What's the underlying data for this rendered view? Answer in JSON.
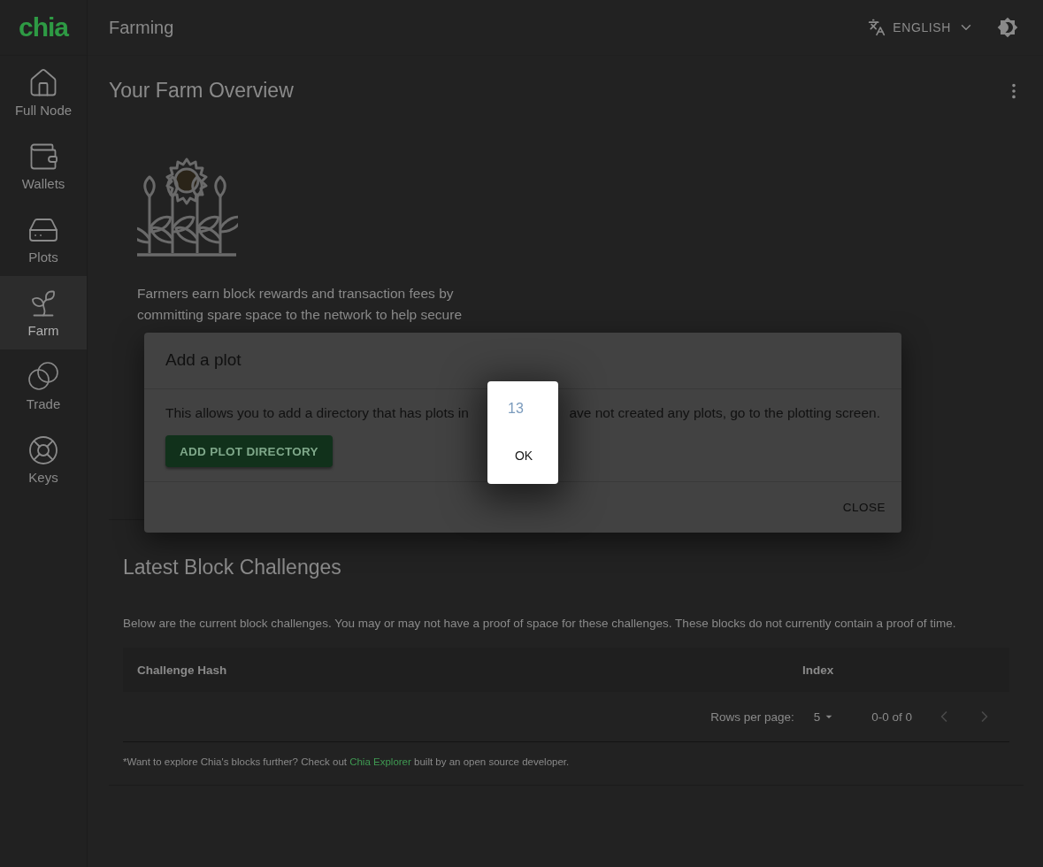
{
  "logo": "chia",
  "sidebar": {
    "items": [
      {
        "label": "Full Node",
        "selected": false
      },
      {
        "label": "Wallets",
        "selected": false
      },
      {
        "label": "Plots",
        "selected": false
      },
      {
        "label": "Farm",
        "selected": true
      },
      {
        "label": "Trade",
        "selected": false
      },
      {
        "label": "Keys",
        "selected": false
      }
    ]
  },
  "header": {
    "title": "Farming",
    "language": "ENGLISH"
  },
  "overview": {
    "title": "Your Farm Overview",
    "description": "Farmers earn block rewards and transaction fees by committing spare space to the network to help secure"
  },
  "challenges": {
    "title": "Latest Block Challenges",
    "description": "Below are the current block challenges. You may or may not have a proof of space for these challenges. These blocks do not currently contain a proof of time.",
    "columns": [
      "Challenge Hash",
      "Index"
    ],
    "pagination": {
      "rows_label": "Rows per page:",
      "rows": "5",
      "range": "0-0 of 0",
      "prev_disabled": true,
      "next_disabled": true
    },
    "footnote": {
      "before": "*Want to explore Chia's blocks further? Check out ",
      "link": "Chia Explorer",
      "after": " built by an open source developer."
    }
  },
  "dialog": {
    "title": "Add a plot",
    "text_before": "This allows you to add a directory that has plots in",
    "text_after": "ave not created any plots, go to the plotting screen.",
    "button": "ADD PLOT DIRECTORY",
    "close": "CLOSE"
  },
  "alert": {
    "message": "13",
    "button": "OK"
  }
}
